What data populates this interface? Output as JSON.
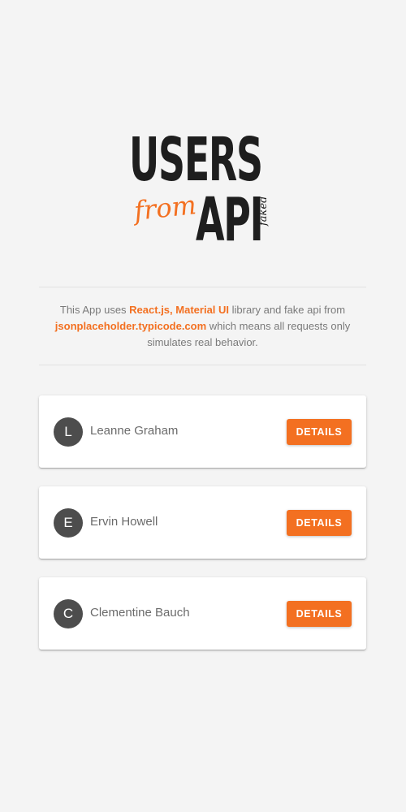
{
  "logo": {
    "line1": "USERS",
    "from": "from",
    "api": "API",
    "faked": "faked"
  },
  "description": {
    "text1": "This App uses ",
    "react": "React.js",
    "comma": ", ",
    "mui": "Material UI",
    "text2": " library and fake api from ",
    "api_host": "jsonplaceholder.typicode.com",
    "text3": " which means all requests only simulates real behavior."
  },
  "users": [
    {
      "initial": "L",
      "name": "Leanne Graham",
      "button": "DETAILS"
    },
    {
      "initial": "E",
      "name": "Ervin Howell",
      "button": "DETAILS"
    },
    {
      "initial": "C",
      "name": "Clementine Bauch",
      "button": "DETAILS"
    }
  ],
  "colors": {
    "accent": "#f37021",
    "background": "#f4f4f4",
    "avatar": "#4d4d4d"
  }
}
